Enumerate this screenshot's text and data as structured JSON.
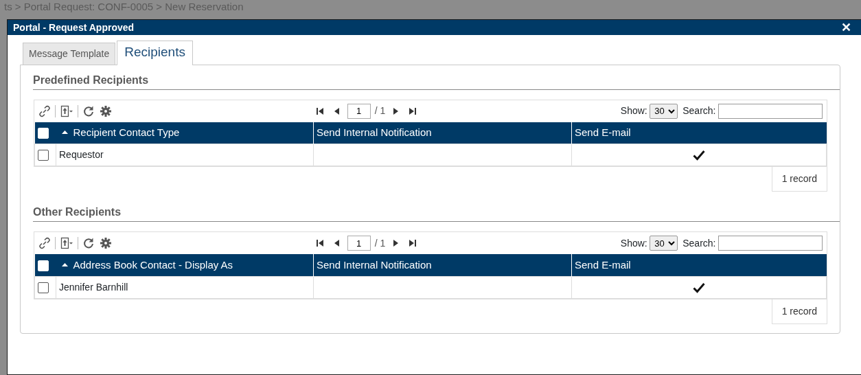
{
  "background_page": {
    "breadcrumb": "ts > Portal Request: CONF-0005 > New Reservation"
  },
  "dialog": {
    "title": "Portal - Request Approved",
    "close": "✕"
  },
  "tabs": [
    {
      "label": "Message Template",
      "selected": false
    },
    {
      "label": "Recipients",
      "selected": true
    }
  ],
  "sections": [
    {
      "title": "Predefined Recipients",
      "grid": {
        "page": "1",
        "page_total": "/ 1",
        "show_label": "Show:",
        "show_value": "30",
        "search_label": "Search:",
        "columns": [
          "Recipient Contact Type",
          "Send Internal Notification",
          "Send E-mail"
        ],
        "all_checked": false,
        "rows": [
          {
            "cells": [
              "Requestor"
            ],
            "checked": false,
            "send_internal_notification": false,
            "send_email": true
          }
        ],
        "record_count": "1 record"
      }
    },
    {
      "title": "Other Recipients",
      "grid": {
        "page": "1",
        "page_total": "/ 1",
        "show_label": "Show:",
        "show_value": "30",
        "search_label": "Search:",
        "columns": [
          "Address Book Contact - Display As",
          "Send Internal Notification",
          "Send E-mail"
        ],
        "all_checked": false,
        "rows": [
          {
            "cells": [
              "Jennifer Barnhill"
            ],
            "checked": false,
            "send_internal_notification": false,
            "send_email": true
          }
        ],
        "record_count": "1 record"
      }
    }
  ]
}
